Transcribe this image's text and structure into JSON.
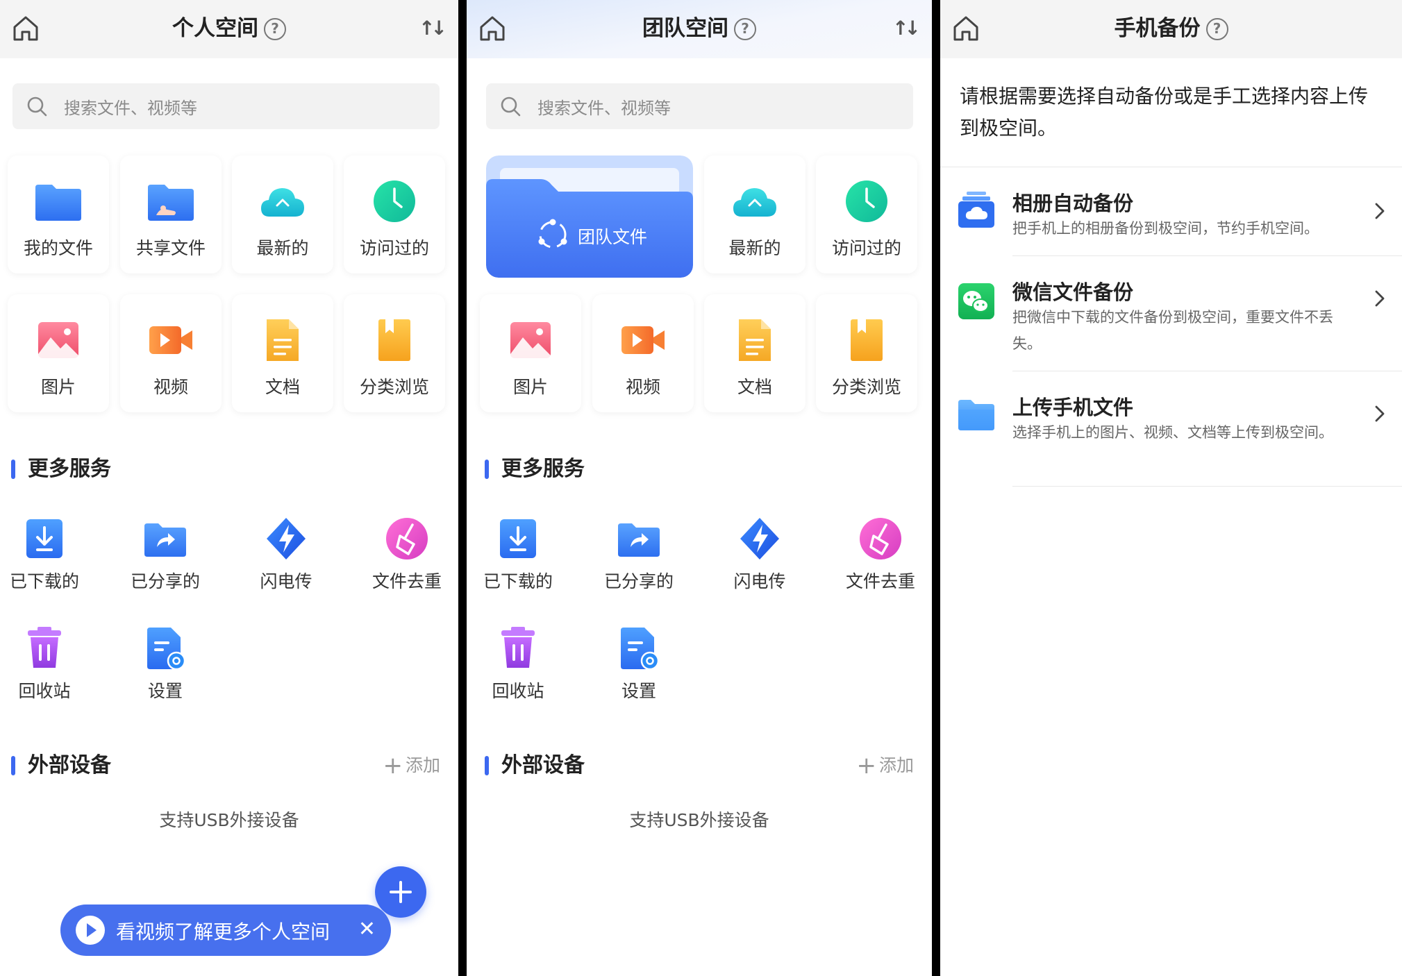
{
  "panels": {
    "personal": {
      "title": "个人空间",
      "search_placeholder": "搜索文件、视频等",
      "tiles": [
        "我的文件",
        "共享文件",
        "最新的",
        "访问过的",
        "图片",
        "视频",
        "文档",
        "分类浏览"
      ],
      "more_services_title": "更多服务",
      "services": [
        "已下载的",
        "已分享的",
        "闪电传",
        "文件去重",
        "回收站",
        "设置"
      ],
      "external_title": "外部设备",
      "add_label": "添加",
      "usb_note": "支持USB外接设备",
      "video_banner": "看视频了解更多个人空间"
    },
    "team": {
      "title": "团队空间",
      "search_placeholder": "搜索文件、视频等",
      "team_card_label": "团队文件",
      "tiles": [
        "最新的",
        "访问过的",
        "图片",
        "视频",
        "文档",
        "分类浏览"
      ],
      "more_services_title": "更多服务",
      "services": [
        "已下载的",
        "已分享的",
        "闪电传",
        "文件去重",
        "回收站",
        "设置"
      ],
      "external_title": "外部设备",
      "add_label": "添加",
      "usb_note": "支持USB外接设备"
    },
    "backup": {
      "title": "手机备份",
      "intro": "请根据需要选择自动备份或是手工选择内容上传到极空间。",
      "rows": [
        {
          "title": "相册自动备份",
          "desc": "把手机上的相册备份到极空间，节约手机空间。"
        },
        {
          "title": "微信文件备份",
          "desc": "把微信中下载的文件备份到极空间，重要文件不丢失。"
        },
        {
          "title": "上传手机文件",
          "desc": "选择手机上的图片、视频、文档等上传到极空间。"
        }
      ]
    }
  },
  "colors": {
    "accent": "#3c68f0",
    "folder_blue": "#3d86f5",
    "cloud_teal": "#1ec8d4",
    "clock_green": "#20cfa0",
    "doc_orange": "#f7b13a",
    "video_orange": "#f77f33",
    "image_pink": "#f0617a",
    "dedupe_pink": "#e94bd0",
    "trash_purple": "#a44be6",
    "wechat_green": "#1cc15b"
  },
  "icons": {
    "home": "home-icon",
    "help": "help-icon",
    "sort": "sort-icon",
    "search": "search-icon",
    "chevron": "chevron-right-icon"
  }
}
